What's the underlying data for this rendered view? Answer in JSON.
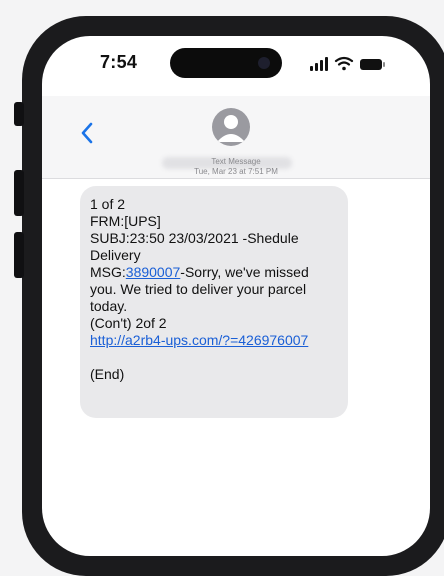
{
  "status_bar": {
    "time": "7:54",
    "icons": [
      "cellular-signal-icon",
      "wifi-icon",
      "battery-icon"
    ]
  },
  "header": {
    "back_icon": "chevron-left-icon",
    "avatar_icon": "contact-avatar-icon"
  },
  "conversation": {
    "service_label": "Text Message",
    "timestamp": "Tue, Mar 23 at 7:51 PM",
    "message": {
      "line1": "1 of 2",
      "line2": "FRM:[UPS]",
      "line3": "SUBJ:23:50 23/03/2021 -Shedule",
      "line4": "Delivery",
      "msg_label": "MSG:",
      "msg_number": "3890007",
      "msg_rest": "-Sorry, we've missed",
      "line6": "you. We tried to deliver your parcel",
      "line7": "today.",
      "line8": "(Con't) 2of 2",
      "link": "http://a2rb4-ups.com/?=426976007",
      "end": "(End)"
    }
  },
  "colors": {
    "frame": "#1b1b1d",
    "bubble": "#e9e9eb",
    "link": "#1a5fd6",
    "header_bg": "#f6f6f7"
  }
}
